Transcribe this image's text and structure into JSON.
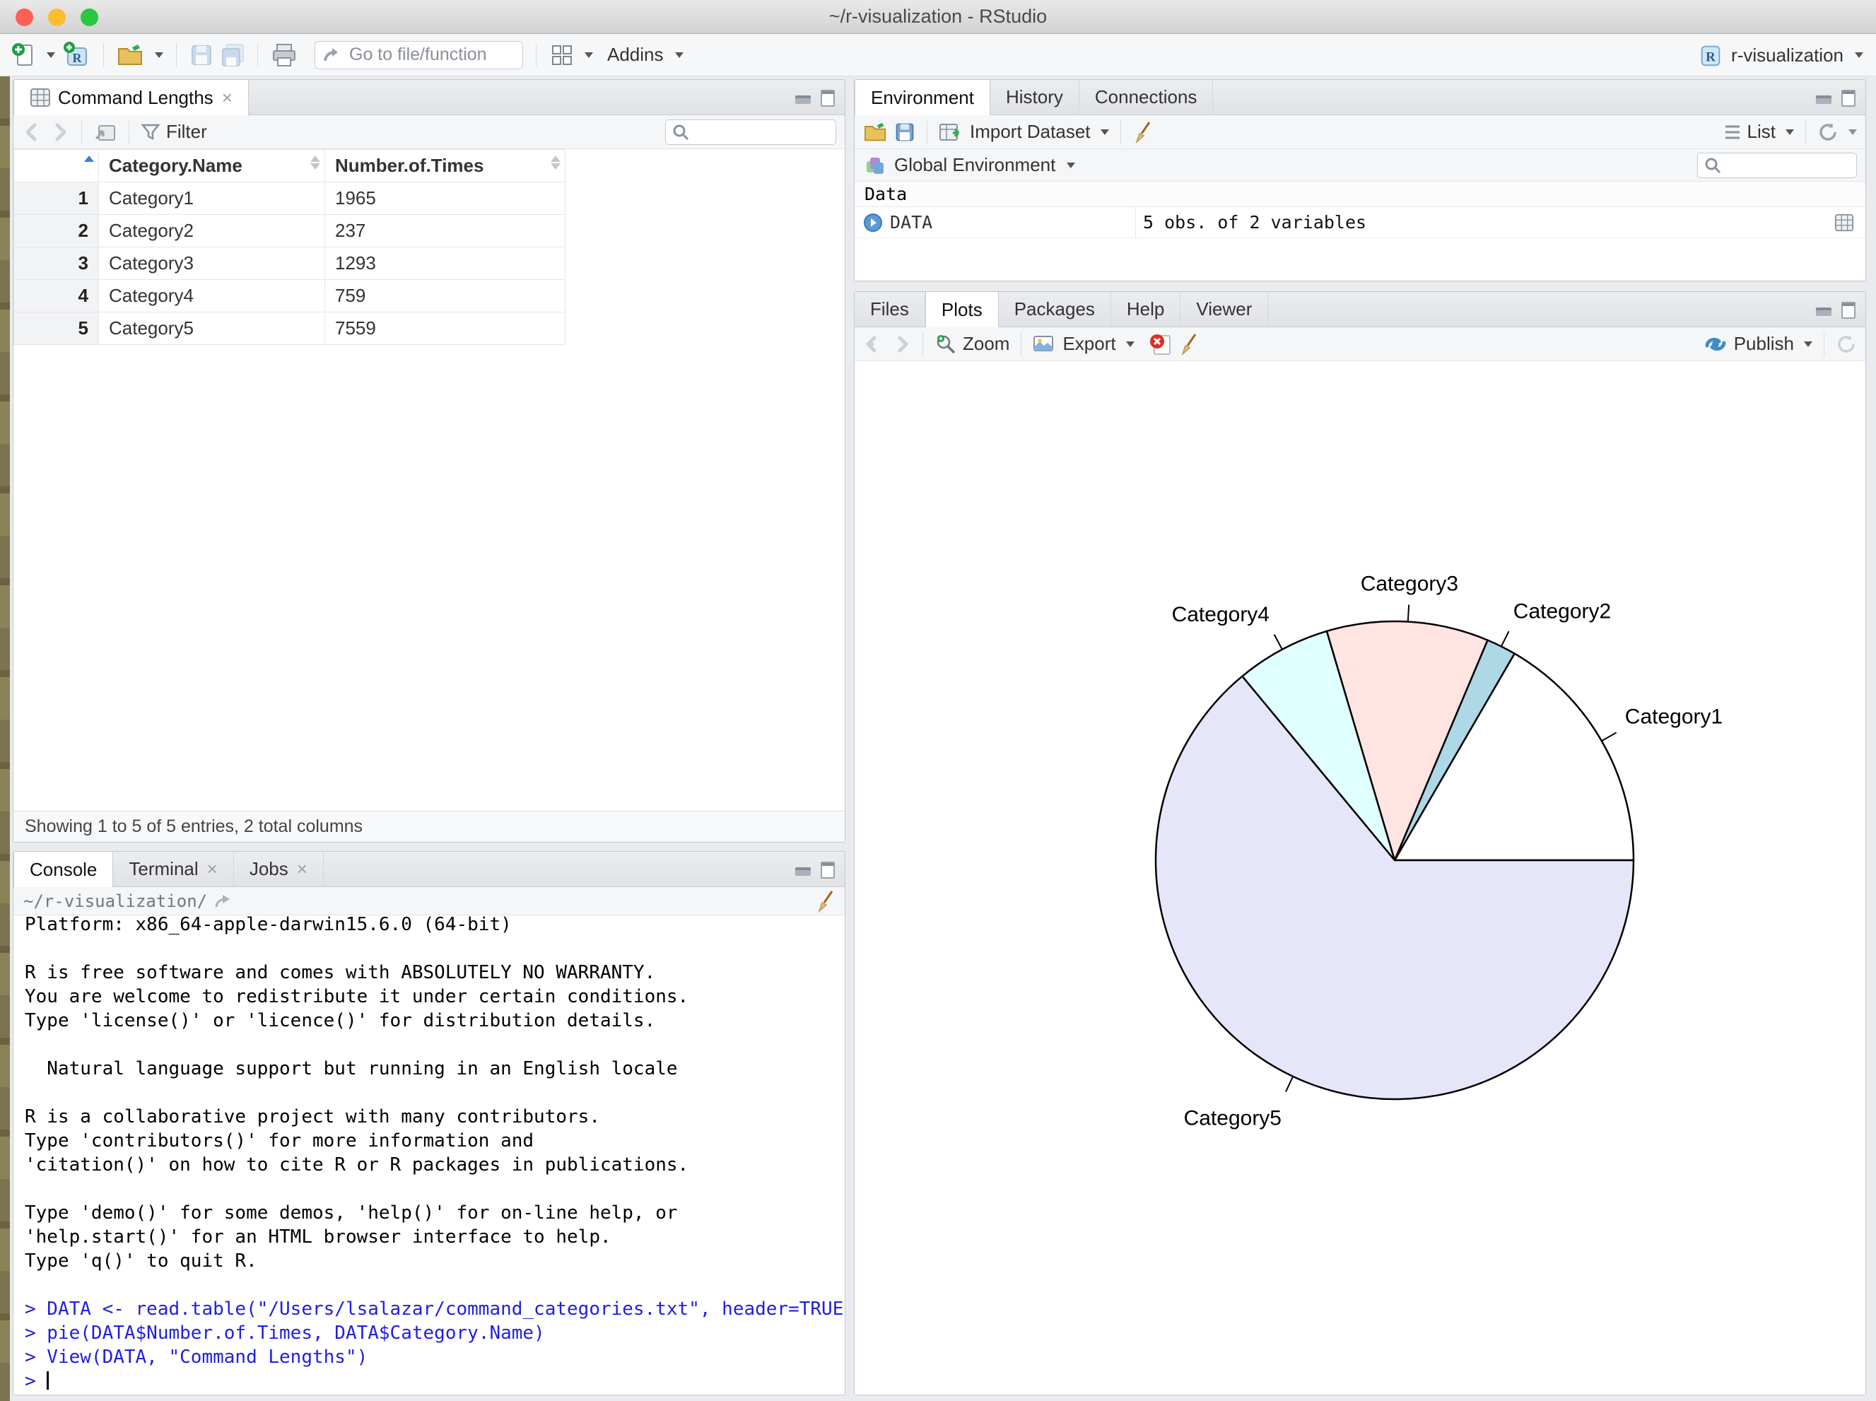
{
  "window": {
    "title": "~/r-visualization - RStudio"
  },
  "toolbar": {
    "goto_placeholder": "Go to file/function",
    "addins_label": "Addins",
    "project_label": "r-visualization"
  },
  "data_viewer": {
    "tab": "Command Lengths",
    "filter_label": "Filter",
    "columns": [
      "Category.Name",
      "Number.of.Times"
    ],
    "rows": [
      {
        "n": "1",
        "name": "Category1",
        "times": "1965"
      },
      {
        "n": "2",
        "name": "Category2",
        "times": "237"
      },
      {
        "n": "3",
        "name": "Category3",
        "times": "1293"
      },
      {
        "n": "4",
        "name": "Category4",
        "times": "759"
      },
      {
        "n": "5",
        "name": "Category5",
        "times": "7559"
      }
    ],
    "footer": "Showing 1 to 5 of 5 entries, 2 total columns"
  },
  "environment": {
    "tabs": [
      "Environment",
      "History",
      "Connections"
    ],
    "active_tab": "Environment",
    "import_label": "Import Dataset",
    "list_label": "List",
    "scope_label": "Global Environment",
    "section_label": "Data",
    "objects": [
      {
        "name": "DATA",
        "value": "5 obs. of 2 variables"
      }
    ]
  },
  "plots_pane": {
    "tabs": [
      "Files",
      "Plots",
      "Packages",
      "Help",
      "Viewer"
    ],
    "active_tab": "Plots",
    "zoom_label": "Zoom",
    "export_label": "Export",
    "publish_label": "Publish"
  },
  "console": {
    "tabs": [
      "Console",
      "Terminal",
      "Jobs"
    ],
    "active_tab": "Console",
    "path": "~/r-visualization/",
    "output_lines": [
      "Platform: x86_64-apple-darwin15.6.0 (64-bit)",
      "",
      "R is free software and comes with ABSOLUTELY NO WARRANTY.",
      "You are welcome to redistribute it under certain conditions.",
      "Type 'license()' or 'licence()' for distribution details.",
      "",
      "  Natural language support but running in an English locale",
      "",
      "R is a collaborative project with many contributors.",
      "Type 'contributors()' for more information and",
      "'citation()' on how to cite R or R packages in publications.",
      "",
      "Type 'demo()' for some demos, 'help()' for on-line help, or",
      "'help.start()' for an HTML browser interface to help.",
      "Type 'q()' to quit R.",
      ""
    ],
    "commands": [
      "DATA <- read.table(\"/Users/lsalazar/command_categories.txt\", header=TRUE)",
      "pie(DATA$Number.of.Times, DATA$Category.Name)",
      "View(DATA, \"Command Lengths\")"
    ],
    "prompt": ">"
  },
  "chart_data": {
    "type": "pie",
    "title": "",
    "categories": [
      "Category1",
      "Category2",
      "Category3",
      "Category4",
      "Category5"
    ],
    "values": [
      1965,
      237,
      1293,
      759,
      7559
    ],
    "colors": [
      "#FFFFFF",
      "#ADD8E6",
      "#FFE4E1",
      "#E0FFFF",
      "#E6E6FA"
    ],
    "start_angle_deg": 0,
    "direction": "counterclockwise",
    "stroke": "#000000",
    "legend": "labels-around-slices"
  },
  "colors": {
    "command_blue": "#1f1fe0",
    "traffic_red": "#ff5f57",
    "traffic_yellow": "#febc2e",
    "traffic_green": "#28c840",
    "publish_blue": "#3d8dc6"
  }
}
